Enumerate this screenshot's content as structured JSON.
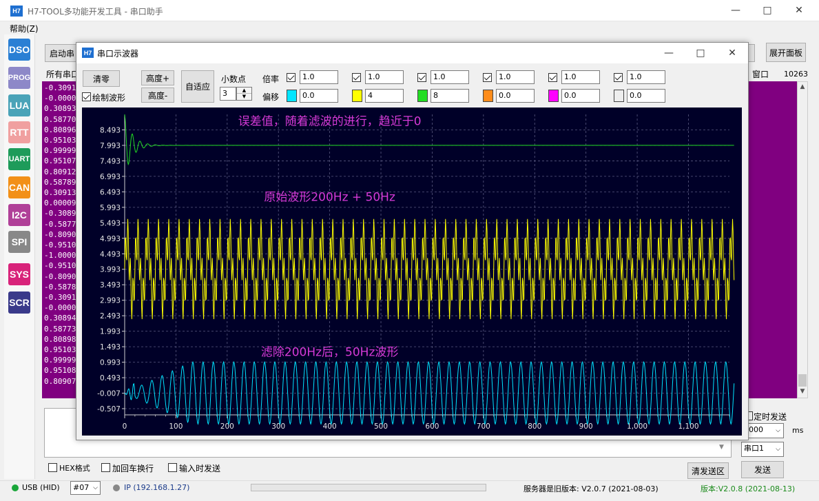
{
  "main_window": {
    "title": "H7-TOOL多功能开发工具 - 串口助手",
    "logo": "H7",
    "menu_help": "帮助(Z)"
  },
  "sidebar": {
    "items": [
      {
        "label": "DSO",
        "color": "#2a7fd4"
      },
      {
        "label": "PROG",
        "color": "#8d88c8"
      },
      {
        "label": "LUA",
        "color": "#4aa3b8"
      },
      {
        "label": "RTT",
        "color": "#f0a0a0"
      },
      {
        "label": "UART",
        "color": "#1e9b5a"
      },
      {
        "label": "CAN",
        "color": "#f29018"
      },
      {
        "label": "I2C",
        "color": "#b04098"
      },
      {
        "label": "SPI",
        "color": "#888888"
      },
      {
        "label": "SYS",
        "color": "#d8237a"
      },
      {
        "label": "SCR",
        "color": "#3a3a8a"
      }
    ]
  },
  "background_panel": {
    "start_button": "启动串",
    "all_serial_label": "所有串口",
    "expand_panel": "展开面板",
    "window_label": "窗口",
    "count": "10263",
    "receive_lines": [
      "-0.3091",
      "-0.0000",
      "0.30893",
      "0.58770",
      "0.80896",
      "0.95103",
      "0.99999",
      "0.95107",
      "0.80912",
      "0.58789",
      "0.30913",
      "0.00009",
      "-0.3089",
      "-0.5877",
      "-0.8090",
      "-0.9510",
      "-1.0000",
      "-0.9510",
      "-0.8090",
      "-0.5878",
      "-0.3091",
      "-0.0000",
      "0.30894",
      "0.58773",
      "0.80898",
      "0.95103",
      "0.99999",
      "0.95108",
      "0.80907"
    ],
    "timed_send": "定时发送",
    "interval_value": "1000",
    "interval_unit": "ms",
    "port_select": "串口1",
    "send_button": "发送",
    "clear_send_button": "清发送区",
    "hex_format": "HEX格式",
    "add_crlf": "加回车换行",
    "send_on_input": "输入时发送"
  },
  "status_bar": {
    "usb": "USB (HID)",
    "port": "#07",
    "ip": "IP (192.168.1.27)",
    "server_version": "服务器是旧版本: V2.0.7 (2021-08-03)",
    "version": "版本:V2.0.8 (2021-08-13)"
  },
  "scope_window": {
    "title": "串口示波器",
    "logo": "H7",
    "clear_button": "清零",
    "draw_wave_label": "绘制波形",
    "height_plus": "高度+",
    "height_minus": "高度-",
    "auto_fit": "自适应",
    "decimals_label": "小数点",
    "decimals_value": "3",
    "scale_label": "倍率",
    "offset_label": "偏移",
    "channels": [
      {
        "scale": "1.0",
        "offset": "0.0",
        "color": "#00e5ff",
        "enabled": true
      },
      {
        "scale": "1.0",
        "offset": "4",
        "color": "#ffff00",
        "enabled": true
      },
      {
        "scale": "1.0",
        "offset": "8",
        "color": "#22dd22",
        "enabled": true
      },
      {
        "scale": "1.0",
        "offset": "0.0",
        "color": "#ff8c1a",
        "enabled": true
      },
      {
        "scale": "1.0",
        "offset": "0.0",
        "color": "#ff00ff",
        "enabled": true
      },
      {
        "scale": "1.0",
        "offset": "0.0",
        "color": "#eeeeee",
        "enabled": true
      }
    ]
  },
  "chart_data": {
    "type": "line",
    "title": "",
    "xlabel": "",
    "ylabel": "",
    "xlim": [
      0,
      1180
    ],
    "ylim": [
      -0.707,
      8.993
    ],
    "grid": true,
    "x_ticks": [
      "0",
      "100",
      "200",
      "300",
      "400",
      "500",
      "600",
      "700",
      "800",
      "900",
      "1,000",
      "1,100"
    ],
    "x_tick_values": [
      0,
      100,
      200,
      300,
      400,
      500,
      600,
      700,
      800,
      900,
      1000,
      1100
    ],
    "y_ticks": [
      "8.493",
      "7.993",
      "7.493",
      "6.993",
      "6.493",
      "5.993",
      "5.493",
      "4.993",
      "4.493",
      "3.993",
      "3.493",
      "2.993",
      "2.493",
      "1.993",
      "1.493",
      "0.993",
      "0.493",
      "-0.007",
      "-0.507"
    ],
    "y_tick_values": [
      8.493,
      7.993,
      7.493,
      6.993,
      6.493,
      5.993,
      5.493,
      4.993,
      4.493,
      3.993,
      3.493,
      2.993,
      2.493,
      1.993,
      1.493,
      0.993,
      0.493,
      -0.007,
      -0.507
    ],
    "annotations": [
      {
        "text": "误差值，随着滤波的进行，趋近于0",
        "x": 400,
        "y": 8.65
      },
      {
        "text": "原始波形200Hz + 50Hz",
        "x": 400,
        "y": 6.2
      },
      {
        "text": "滤除200Hz后，50Hz波形",
        "x": 400,
        "y": 1.2
      }
    ],
    "series": [
      {
        "color": "#22dd22",
        "center": 7.993,
        "kind": "error_decay",
        "initial_amplitude": 1.0,
        "period": 15,
        "decay_samples": 45
      },
      {
        "color": "#ffff00",
        "center": 4.0,
        "kind": "sum_sines",
        "freq1_period": 20,
        "amp1": 1.0,
        "freq2_period": 5,
        "amp2": 0.7
      },
      {
        "color": "#00e5ff",
        "center": 0.0,
        "kind": "filtered_sine",
        "period": 20,
        "amplitude": 1.0,
        "settle_samples": 130
      }
    ]
  }
}
